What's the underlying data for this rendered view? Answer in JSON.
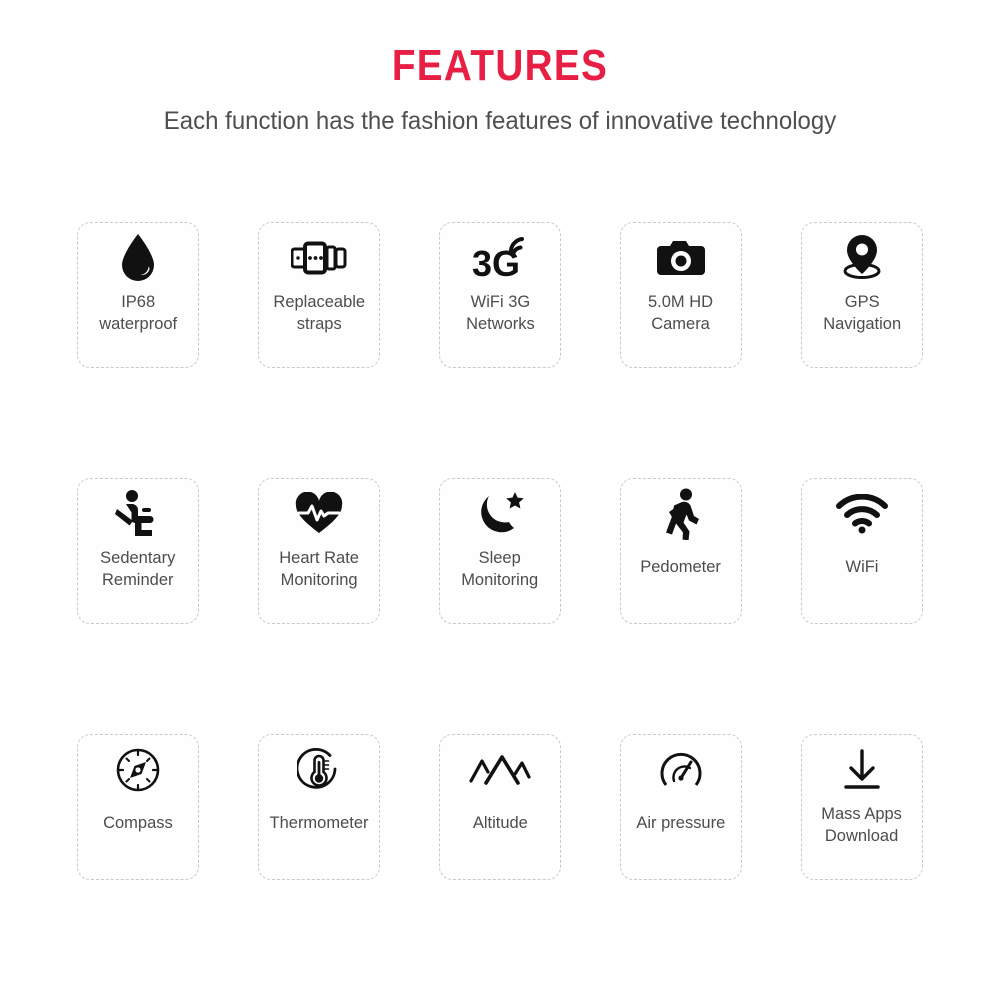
{
  "header": {
    "title": "FEATURES",
    "subtitle": "Each function has the fashion features of innovative technology",
    "title_color": "#e81f45",
    "subtitle_color": "#4f4f4f"
  },
  "style": {
    "background": "#ffffff",
    "card_border_color": "#c9c9c9",
    "icon_color": "#111111",
    "label_color": "#4d4d4d"
  },
  "features": [
    {
      "icon": "water-drop-icon",
      "label": "IP68\nwaterproof"
    },
    {
      "icon": "watch-strap-icon",
      "label": "Replaceable\nstraps"
    },
    {
      "icon": "3g-signal-icon",
      "label": "WiFi 3G\nNetworks"
    },
    {
      "icon": "camera-icon",
      "label": "5.0M HD\nCamera"
    },
    {
      "icon": "location-pin-icon",
      "label": "GPS\nNavigation"
    },
    {
      "icon": "seated-person-icon",
      "label": "Sedentary\nReminder"
    },
    {
      "icon": "heart-pulse-icon",
      "label": "Heart Rate\nMonitoring"
    },
    {
      "icon": "moon-star-icon",
      "label": "Sleep\nMonitoring"
    },
    {
      "icon": "walking-person-icon",
      "label": "Pedometer"
    },
    {
      "icon": "wifi-icon",
      "label": "WiFi"
    },
    {
      "icon": "compass-icon",
      "label": "Compass"
    },
    {
      "icon": "thermometer-icon",
      "label": "Thermometer"
    },
    {
      "icon": "mountain-peaks-icon",
      "label": "Altitude"
    },
    {
      "icon": "pressure-gauge-icon",
      "label": "Air pressure"
    },
    {
      "icon": "download-arrow-icon",
      "label": "Mass Apps\nDownload"
    }
  ]
}
